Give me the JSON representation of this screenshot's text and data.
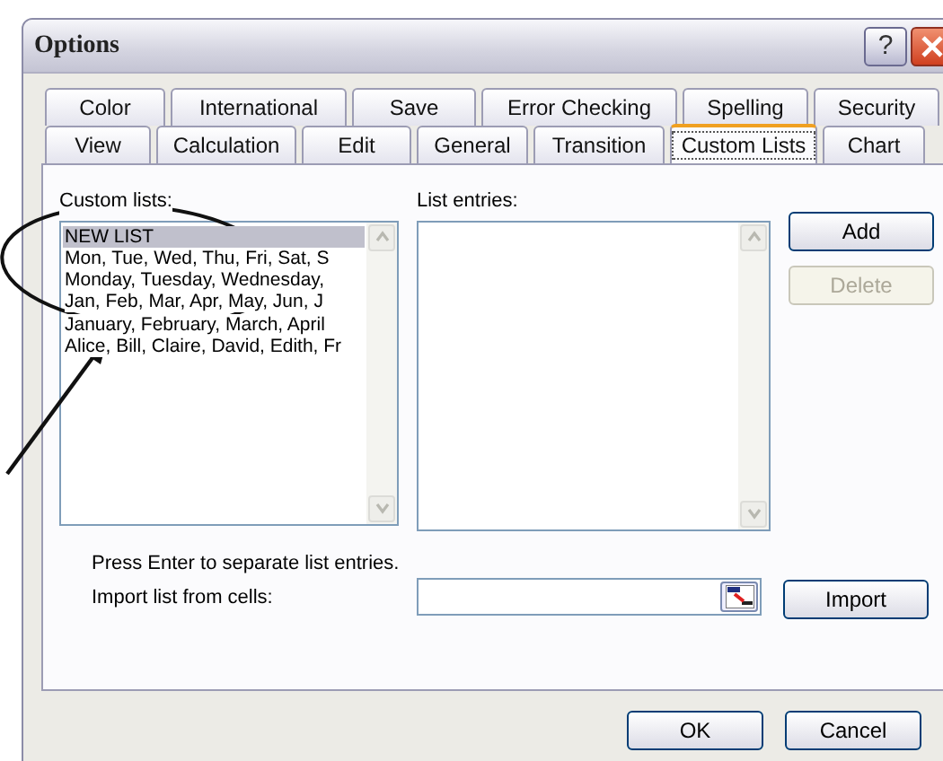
{
  "window": {
    "title": "Options",
    "help_button": "?"
  },
  "tab_rows": [
    [
      {
        "label": "Color",
        "selected": false
      },
      {
        "label": "International",
        "selected": false
      },
      {
        "label": "Save",
        "selected": false
      },
      {
        "label": "Error Checking",
        "selected": false
      },
      {
        "label": "Spelling",
        "selected": false
      },
      {
        "label": "Security",
        "selected": false
      }
    ],
    [
      {
        "label": "View",
        "selected": false
      },
      {
        "label": "Calculation",
        "selected": false
      },
      {
        "label": "Edit",
        "selected": false
      },
      {
        "label": "General",
        "selected": false
      },
      {
        "label": "Transition",
        "selected": false
      },
      {
        "label": "Custom Lists",
        "selected": true
      },
      {
        "label": "Chart",
        "selected": false
      }
    ]
  ],
  "custom_lists": {
    "label": "Custom lists:",
    "items": [
      {
        "text": "NEW LIST",
        "selected": true
      },
      {
        "text": "Mon, Tue, Wed, Thu, Fri, Sat, S",
        "selected": false
      },
      {
        "text": "Monday, Tuesday, Wednesday,",
        "selected": false
      },
      {
        "text": "Jan, Feb, Mar, Apr, May, Jun, J",
        "selected": false
      },
      {
        "text": "January, February, March, April",
        "selected": false
      },
      {
        "text": "Alice, Bill, Claire, David, Edith, Fr",
        "selected": false
      }
    ]
  },
  "list_entries": {
    "label": "List entries:"
  },
  "side_buttons": [
    {
      "label": "Add",
      "disabled": false
    },
    {
      "label": "Delete",
      "disabled": true
    }
  ],
  "hint": "Press Enter to separate list entries.",
  "import": {
    "label": "Import list from cells:",
    "button": "Import"
  },
  "footer_buttons": [
    "OK",
    "Cancel"
  ]
}
